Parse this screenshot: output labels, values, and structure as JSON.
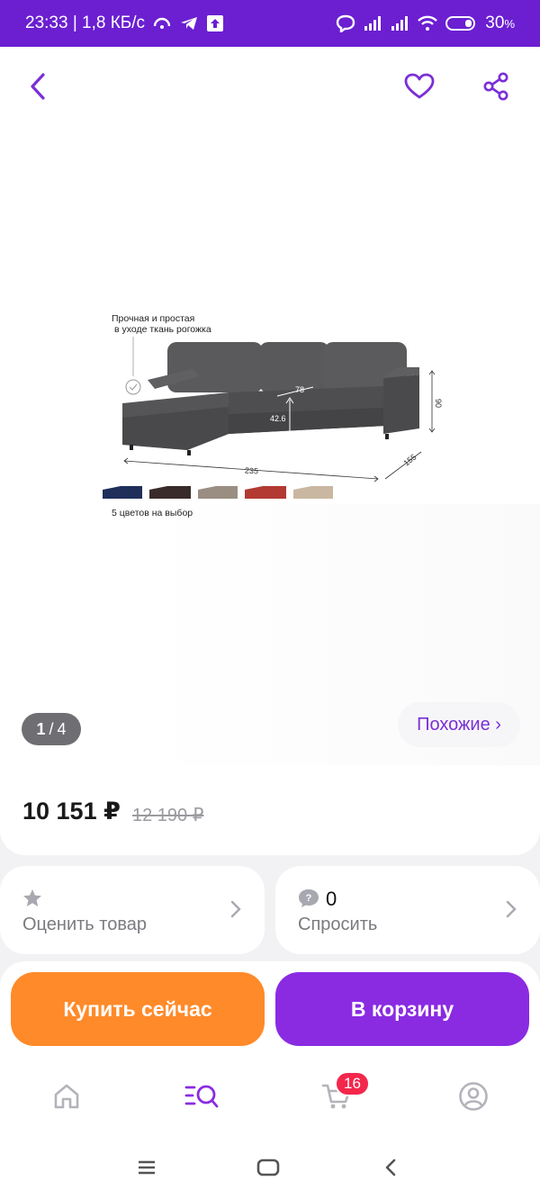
{
  "status_bar": {
    "time_speed": "23:33 | 1,8 КБ/с",
    "battery": "30",
    "battery_unit": "%"
  },
  "top_bar": {
    "back_icon": "chevron-left-icon",
    "favorite_icon": "heart-icon",
    "share_icon": "share-icon"
  },
  "gallery": {
    "caption_line1": "Прочная и простая",
    "caption_line2": "в уходе ткань рогожка",
    "colors_caption": "5 цветов на выбор",
    "dims": {
      "depth": "78",
      "seat_height": "42.6",
      "height": "90",
      "width": "235",
      "chaise": "155"
    },
    "swatch_colors": [
      "#1f2f5a",
      "#3a2b2b",
      "#9a8d82",
      "#b23a33",
      "#c9b7a2"
    ],
    "counter_current": "1",
    "counter_sep": "/",
    "counter_total": "4",
    "similar_label": "Похожие ›"
  },
  "price": {
    "current": "10 151 ₽",
    "old": "12 190 ₽"
  },
  "rate_card": {
    "label": "Оценить товар",
    "icon": "star-icon"
  },
  "ask_card": {
    "count": "0",
    "label": "Спросить",
    "icon": "question-bubble-icon"
  },
  "actions": {
    "buy_now": "Купить сейчас",
    "add_to_cart": "В корзину"
  },
  "tab_bar": {
    "cart_badge": "16",
    "active_tab": "catalog",
    "accent": "#8a2be2"
  },
  "colors": {
    "brand": "#6b1fd1",
    "buy": "#ff8a2a",
    "cart": "#8a2be2",
    "badge": "#f3274c"
  }
}
